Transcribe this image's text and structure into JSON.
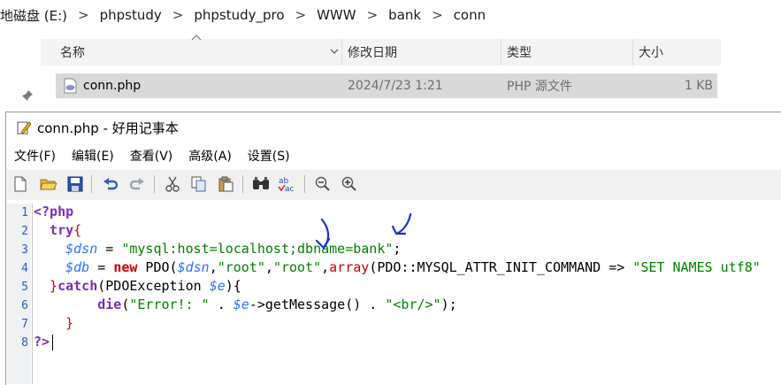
{
  "breadcrumb": [
    "地磁盘 (E:)",
    "phpstudy",
    "phpstudy_pro",
    "WWW",
    "bank",
    "conn"
  ],
  "explorer": {
    "columns": [
      "名称",
      "修改日期",
      "类型",
      "大小"
    ],
    "row": {
      "name": "conn.php",
      "modified": "2024/7/23 1:21",
      "type": "PHP 源文件",
      "size": "1 KB"
    }
  },
  "notepad": {
    "title": "conn.php - 好用记事本",
    "menu": [
      "文件(F)",
      "编辑(E)",
      "查看(V)",
      "高级(A)",
      "设置(S)"
    ],
    "toolbar_icons": [
      "new-file-icon",
      "open-folder-icon",
      "save-icon",
      "undo-icon",
      "redo-icon",
      "cut-icon",
      "copy-icon",
      "paste-icon",
      "find-icon",
      "spellcheck-icon",
      "zoom-out-icon",
      "zoom-in-icon"
    ],
    "line_numbers": [
      "1",
      "2",
      "3",
      "4",
      "5",
      "6",
      "7",
      "8"
    ],
    "code": {
      "l1": "<?php",
      "l2a": "  try",
      "l2b": "{",
      "l3a": "    ",
      "l3b": "$dsn",
      "l3c": " = ",
      "l3d": "\"mysql:host=localhost;dbname=bank\"",
      "l3e": ";",
      "l4a": "    ",
      "l4b": "$db",
      "l4c": " = ",
      "l4d": "new",
      "l4e": " PDO(",
      "l4f": "$dsn",
      "l4g": ",",
      "l4h": "\"root\"",
      "l4i": ",",
      "l4j": "\"root\"",
      "l4k": ",",
      "l4l": "array",
      "l4m": "(PDO::MYSQL_ATTR_INIT_COMMAND => ",
      "l4n": "\"SET NAMES utf8\"",
      "l5a": "  }",
      "l5b": "catch",
      "l5c": "(PDOException ",
      "l5d": "$e",
      "l5e": "){",
      "l6a": "        ",
      "l6b": "die",
      "l6c": "(",
      "l6d": "\"Error!: \"",
      "l6e": " . ",
      "l6f": "$e",
      "l6g": "->getMessage() . ",
      "l6h": "\"<br/>\"",
      "l6i": ");",
      "l7": "    }",
      "l8": "?>"
    }
  },
  "colors": {
    "keyword": "#0000ff",
    "variable": "#2d72ff",
    "string": "#008000",
    "php_tag": "#7a2db8",
    "annotation": "#1a2fd6"
  }
}
